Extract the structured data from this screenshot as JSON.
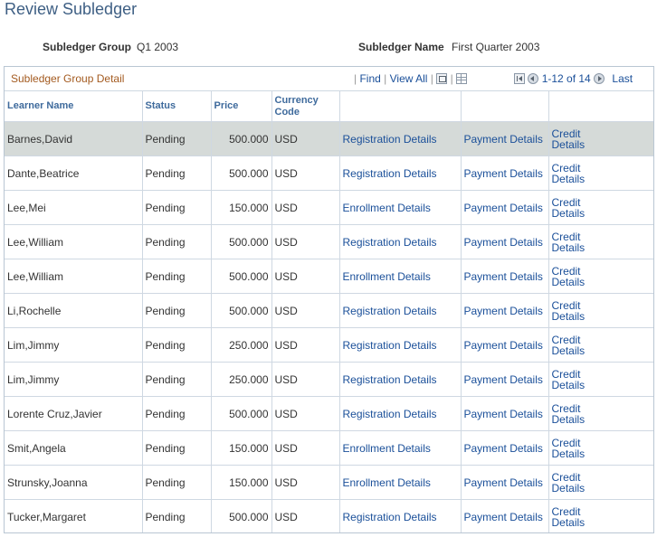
{
  "page": {
    "title": "Review Subledger",
    "subledger_group_label": "Subledger Group",
    "subledger_group_value": "Q1 2003",
    "subledger_name_label": "Subledger Name",
    "subledger_name_value": "First Quarter 2003"
  },
  "grid": {
    "title": "Subledger Group Detail",
    "find_label": "Find",
    "view_all_label": "View All",
    "range_label": "1-12 of 14",
    "last_label": "Last",
    "columns": {
      "learner": "Learner Name",
      "status": "Status",
      "price": "Price",
      "currency": "Currency Code"
    },
    "rows": [
      {
        "learner": "Barnes,David",
        "status": "Pending",
        "price": "500.000",
        "currency": "USD",
        "details": "Registration Details",
        "payment": "Payment Details",
        "credit": "Credit Details"
      },
      {
        "learner": "Dante,Beatrice",
        "status": "Pending",
        "price": "500.000",
        "currency": "USD",
        "details": "Registration Details",
        "payment": "Payment Details",
        "credit": "Credit Details"
      },
      {
        "learner": "Lee,Mei",
        "status": "Pending",
        "price": "150.000",
        "currency": "USD",
        "details": "Enrollment Details",
        "payment": "Payment Details",
        "credit": "Credit Details"
      },
      {
        "learner": "Lee,William",
        "status": "Pending",
        "price": "500.000",
        "currency": "USD",
        "details": "Registration Details",
        "payment": "Payment Details",
        "credit": "Credit Details"
      },
      {
        "learner": "Lee,William",
        "status": "Pending",
        "price": "500.000",
        "currency": "USD",
        "details": "Enrollment Details",
        "payment": "Payment Details",
        "credit": "Credit Details"
      },
      {
        "learner": "Li,Rochelle",
        "status": "Pending",
        "price": "500.000",
        "currency": "USD",
        "details": "Registration Details",
        "payment": "Payment Details",
        "credit": "Credit Details"
      },
      {
        "learner": "Lim,Jimmy",
        "status": "Pending",
        "price": "250.000",
        "currency": "USD",
        "details": "Registration Details",
        "payment": "Payment Details",
        "credit": "Credit Details"
      },
      {
        "learner": "Lim,Jimmy",
        "status": "Pending",
        "price": "250.000",
        "currency": "USD",
        "details": "Registration Details",
        "payment": "Payment Details",
        "credit": "Credit Details"
      },
      {
        "learner": "Lorente Cruz,Javier",
        "status": "Pending",
        "price": "500.000",
        "currency": "USD",
        "details": "Registration Details",
        "payment": "Payment Details",
        "credit": "Credit Details"
      },
      {
        "learner": "Smit,Angela",
        "status": "Pending",
        "price": "150.000",
        "currency": "USD",
        "details": "Enrollment Details",
        "payment": "Payment Details",
        "credit": "Credit Details"
      },
      {
        "learner": "Strunsky,Joanna",
        "status": "Pending",
        "price": "150.000",
        "currency": "USD",
        "details": "Enrollment Details",
        "payment": "Payment Details",
        "credit": "Credit Details"
      },
      {
        "learner": "Tucker,Margaret",
        "status": "Pending",
        "price": "500.000",
        "currency": "USD",
        "details": "Registration Details",
        "payment": "Payment Details",
        "credit": "Credit Details"
      }
    ]
  },
  "icons": {
    "zoom": "zoom-icon",
    "download": "download-grid-icon",
    "first": "first-page-icon",
    "prev": "previous-page-icon",
    "next": "next-page-icon"
  },
  "colors": {
    "title": "#3e5f84",
    "grid_title": "#a35a1f",
    "link": "#1a4f99",
    "selected_row": "#d5dad8"
  }
}
